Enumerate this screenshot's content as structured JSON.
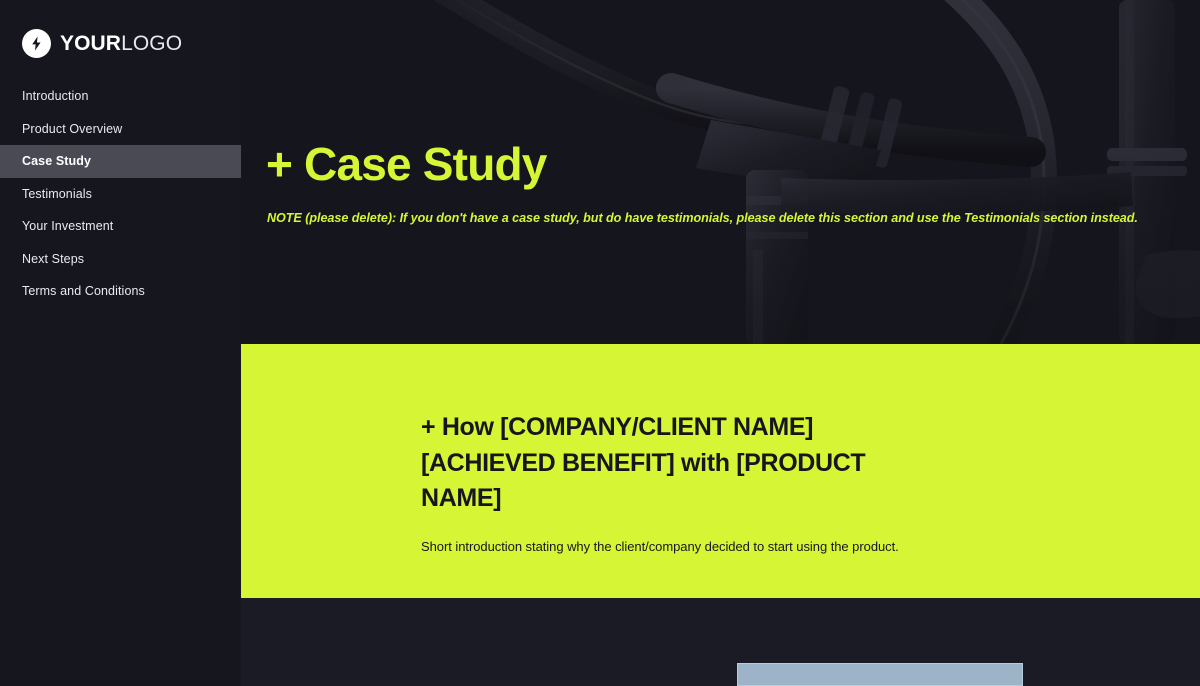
{
  "sidebar": {
    "brand": {
      "mark_icon": "lightning-bolt-icon",
      "name_bold": "YOUR",
      "name_light": "LOGO"
    },
    "items": [
      {
        "label": "Introduction",
        "active": false
      },
      {
        "label": "Product Overview",
        "active": false
      },
      {
        "label": "Case Study",
        "active": true
      },
      {
        "label": "Testimonials",
        "active": false
      },
      {
        "label": "Your Investment",
        "active": false
      },
      {
        "label": "Next Steps",
        "active": false
      },
      {
        "label": "Terms and Conditions",
        "active": false
      }
    ]
  },
  "hero": {
    "title": "+ Case Study",
    "note": "NOTE (please delete): If you don't have a case study, but do have testimonials, please delete this section and use the Testimonials section instead.",
    "photo_subject": "bicycle-handlebars-photo"
  },
  "lime_panel": {
    "heading": "+ How [COMPANY/CLIENT NAME] [ACHIEVED BENEFIT] with [PRODUCT NAME]",
    "body": "Short introduction stating why the client/company decided to start using the product."
  },
  "bottom": {
    "card_label": ""
  },
  "colors": {
    "accent_lime": "#D6F534",
    "sidebar_bg": "#16161F",
    "sidebar_active": "#4A4A55",
    "dark_bg": "#1B1B26",
    "card_blue": "#9DB4C8",
    "text_light": "#E9E9EF",
    "text_dark": "#16161F"
  }
}
